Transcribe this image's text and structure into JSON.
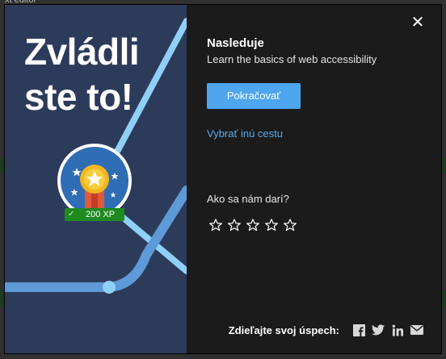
{
  "headline": "Zvládli ste to!",
  "xp_badge": "200 XP",
  "next": {
    "label": "Nasleduje",
    "description": "Learn the basics of web accessibility"
  },
  "buttons": {
    "continue": "Pokračovať",
    "other_path": "Vybrať inú cestu",
    "close": "✕"
  },
  "rating": {
    "label": "Ako sa nám darí?",
    "stars": 5,
    "selected": 0
  },
  "share": {
    "label": "Zdieľajte svoj úspech:",
    "networks": [
      "facebook-icon",
      "twitter-icon",
      "linkedin-icon",
      "email-icon"
    ]
  },
  "background": {
    "top_text": "xt editor"
  },
  "colors": {
    "left_panel": "#2d3b5b",
    "modal_bg": "#1b1b1b",
    "accent": "#4ea6ee",
    "link": "#5aaaf0",
    "path_light": "#8fd0f8",
    "path_mid": "#5e9ad8",
    "xp_green": "#1f8a1f"
  }
}
